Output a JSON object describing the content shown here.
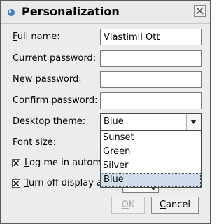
{
  "window": {
    "title": "Personalization",
    "close_icon": "close-icon",
    "app_icon": "app-drop-icon"
  },
  "form": {
    "full_name": {
      "label_ul": "F",
      "label_rest": "ull name:",
      "value": "Vlastimil Ott"
    },
    "current_password": {
      "label_pre": "C",
      "label_ul": "u",
      "label_rest": "rrent password:",
      "value": ""
    },
    "new_password": {
      "label_ul": "N",
      "label_rest": "ew password:",
      "value": ""
    },
    "confirm_password": {
      "label_pre": "Confirm ",
      "label_ul": "p",
      "label_rest": "assword:",
      "value": ""
    },
    "desktop_theme": {
      "label_ul": "D",
      "label_rest": "esktop theme:",
      "selected": "Blue",
      "options": [
        "Sunset",
        "Green",
        "Silver",
        "Blue"
      ]
    },
    "font_size": {
      "label": "Font size:"
    },
    "log_me_in": {
      "label_ul": "L",
      "label_rest": "og me in autom",
      "checked": true
    },
    "turn_off_display": {
      "label_ul": "T",
      "label_rest": "urn off display a",
      "checked": true
    }
  },
  "buttons": {
    "ok": {
      "label_ul": "O",
      "label_rest": "K",
      "enabled": false
    },
    "cancel": {
      "label_ul": "C",
      "label_rest": "ancel",
      "enabled": true
    }
  }
}
